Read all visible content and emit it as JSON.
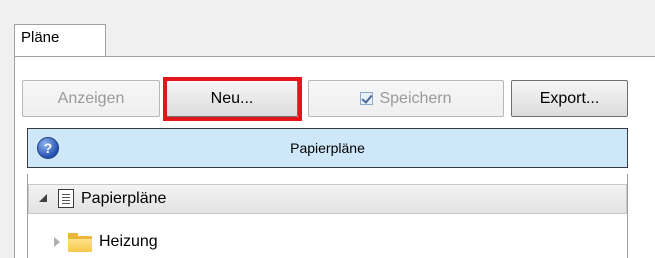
{
  "tabs": [
    {
      "label": "Pläne"
    }
  ],
  "toolbar": {
    "show_label": "Anzeigen",
    "new_label": "Neu...",
    "save_label": "Speichern",
    "export_label": "Export..."
  },
  "header": {
    "title": "Papierpläne",
    "help_icon": "help-icon"
  },
  "tree": {
    "root": {
      "label": "Papierpläne",
      "expanded": true
    },
    "children": [
      {
        "label": "Heizung",
        "expanded": false
      }
    ]
  },
  "colors": {
    "highlight": "#e6151b",
    "header_bg": "#cfe8f9"
  }
}
